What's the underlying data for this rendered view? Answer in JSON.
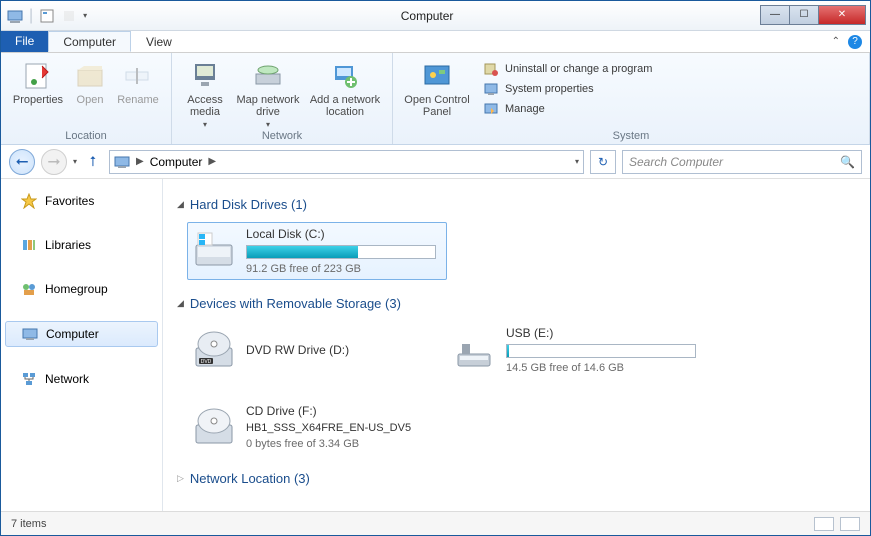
{
  "window": {
    "title": "Computer"
  },
  "tabs": {
    "file": "File",
    "computer": "Computer",
    "view": "View"
  },
  "ribbon": {
    "location": {
      "properties": "Properties",
      "open": "Open",
      "rename": "Rename",
      "label": "Location"
    },
    "network": {
      "access_media": "Access media",
      "map_drive": "Map network drive",
      "add_location": "Add a network location",
      "label": "Network"
    },
    "system": {
      "open_cp": "Open Control Panel",
      "uninstall": "Uninstall or change a program",
      "props": "System properties",
      "manage": "Manage",
      "label": "System"
    }
  },
  "nav": {
    "location": "Computer",
    "search_placeholder": "Search Computer"
  },
  "sidebar": {
    "favorites": "Favorites",
    "libraries": "Libraries",
    "homegroup": "Homegroup",
    "computer": "Computer",
    "network": "Network"
  },
  "sections": {
    "hdd": {
      "title": "Hard Disk Drives (1)"
    },
    "removable": {
      "title": "Devices with Removable Storage (3)"
    },
    "netloc": {
      "title": "Network Location (3)"
    }
  },
  "drives": {
    "c": {
      "name": "Local Disk (C:)",
      "free": "91.2 GB free of 223 GB",
      "fill_pct": 59
    },
    "dvd": {
      "name": "DVD RW Drive (D:)"
    },
    "usb": {
      "name": "USB (E:)",
      "free": "14.5 GB free of 14.6 GB",
      "fill_pct": 1
    },
    "cd": {
      "name": "CD Drive (F:)",
      "sub": "HB1_SSS_X64FRE_EN-US_DV5",
      "free": "0 bytes free of 3.34 GB"
    }
  },
  "status": {
    "count": "7 items"
  }
}
